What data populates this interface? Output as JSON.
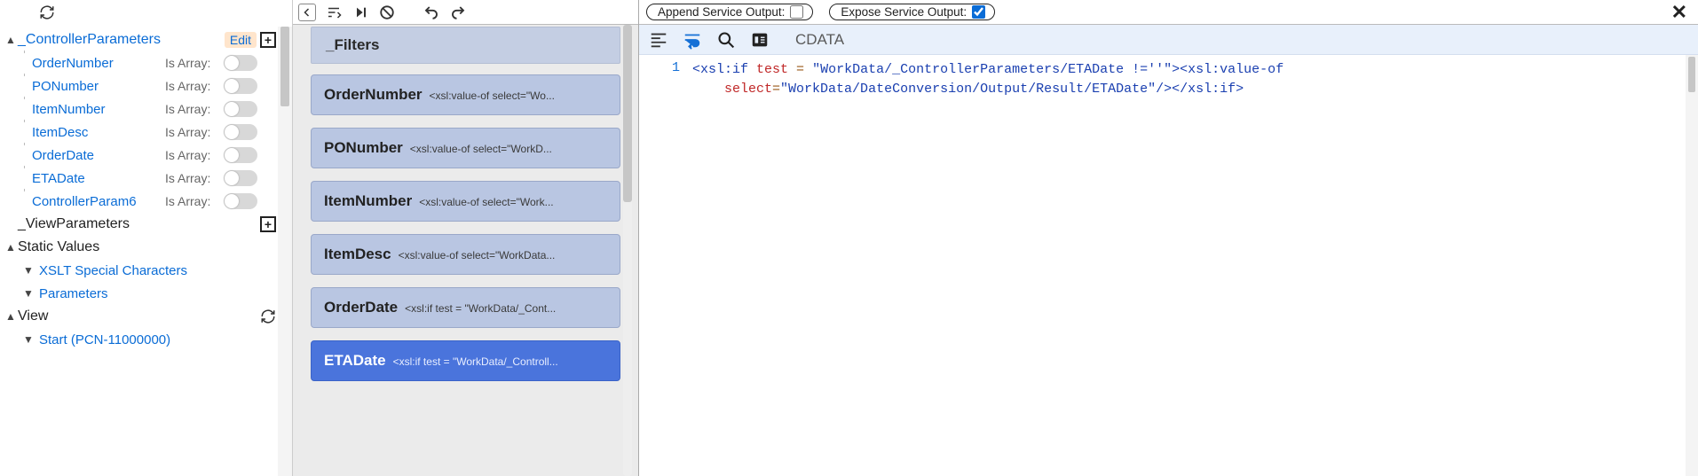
{
  "sidebar": {
    "controller_params_label": "_ControllerParameters",
    "edit_label": "Edit",
    "is_array_label": "Is Array:",
    "params": [
      {
        "name": "OrderNumber"
      },
      {
        "name": "PONumber"
      },
      {
        "name": "ItemNumber"
      },
      {
        "name": "ItemDesc"
      },
      {
        "name": "OrderDate"
      },
      {
        "name": "ETADate"
      },
      {
        "name": "ControllerParam6"
      }
    ],
    "view_parameters_label": "_ViewParameters",
    "static_values_label": "Static Values",
    "xslt_label": "XSLT Special Characters",
    "parameters_label": "Parameters",
    "view_label": "View",
    "start_label": "Start (PCN-11000000)"
  },
  "globalbar": {
    "append_label": "Append Service Output:",
    "expose_label": "Expose Service Output:",
    "append_checked": false,
    "expose_checked": true
  },
  "filters": {
    "header": "_Filters",
    "items": [
      {
        "name": "OrderNumber",
        "sub": "<xsl:value-of select=\"Wo...",
        "selected": false
      },
      {
        "name": "PONumber",
        "sub": "<xsl:value-of select=\"WorkD...",
        "selected": false
      },
      {
        "name": "ItemNumber",
        "sub": "<xsl:value-of select=\"Work...",
        "selected": false
      },
      {
        "name": "ItemDesc",
        "sub": "<xsl:value-of select=\"WorkData...",
        "selected": false
      },
      {
        "name": "OrderDate",
        "sub": "<xsl:if test = \"WorkData/_Cont...",
        "selected": false
      },
      {
        "name": "ETADate",
        "sub": "<xsl:if test = \"WorkData/_Controll...",
        "selected": true
      }
    ]
  },
  "editor": {
    "cdata_label": "CDATA",
    "line_number": "1",
    "code": {
      "l1_a": "<",
      "l1_b": "xsl:if",
      "l1_c": " test",
      "l1_d": " = ",
      "l1_e": "\"WorkData/_ControllerParameters/ETADate !=''\"",
      "l1_f": ">",
      "l1_g": "<",
      "l1_h": "xsl:value-of",
      "l2_a": "select",
      "l2_b": "=",
      "l2_c": "\"WorkData/DateConversion/Output/Result/ETADate\"",
      "l2_d": "/></",
      "l2_e": "xsl:if",
      "l2_f": ">"
    }
  }
}
